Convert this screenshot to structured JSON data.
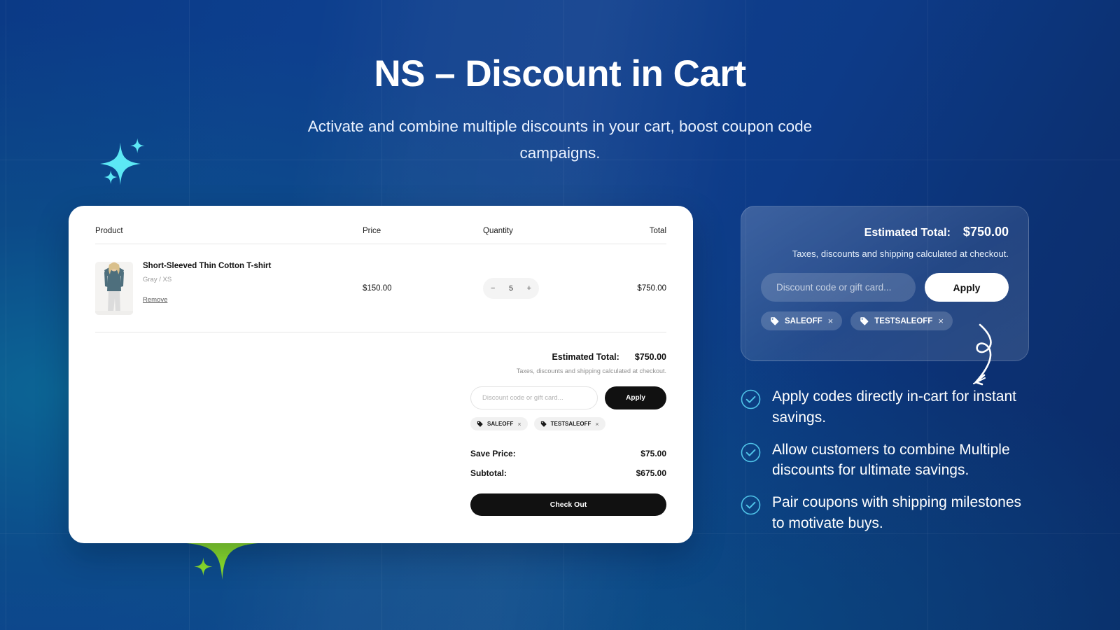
{
  "header": {
    "title": "NS – Discount in Cart",
    "subtitle": "Activate and combine multiple discounts in your cart, boost coupon code campaigns."
  },
  "colors": {
    "background_deep_blue": "#0c3277",
    "background_teal": "#0c6896",
    "sparkle_cyan": "#5ce8f5",
    "sparkle_green": "#8ce02a",
    "accent_check": "#4fc3e8",
    "button_dark": "#111111"
  },
  "cart": {
    "columns": {
      "product": "Product",
      "price": "Price",
      "quantity": "Quantity",
      "total": "Total"
    },
    "items": [
      {
        "name": "Short-Sleeved Thin Cotton T-shirt",
        "variant": "Gray / XS",
        "remove_label": "Remove",
        "price": "$150.00",
        "quantity": "5",
        "decrement": "−",
        "increment": "+",
        "total": "$750.00"
      }
    ],
    "summary": {
      "estimated_total_label": "Estimated Total:",
      "estimated_total_value": "$750.00",
      "note": "Taxes, discounts and shipping calculated at checkout.",
      "discount_placeholder": "Discount code or gift card...",
      "discount_value": "",
      "apply_label": "Apply",
      "chips": [
        {
          "code": "SALEOFF",
          "remove": "×",
          "icon": "tag-icon"
        },
        {
          "code": "TESTSALEOFF",
          "remove": "×",
          "icon": "tag-icon"
        }
      ],
      "save_price_label": "Save Price:",
      "save_price_value": "$75.00",
      "subtotal_label": "Subtotal:",
      "subtotal_value": "$675.00",
      "checkout_label": "Check Out"
    }
  },
  "callout": {
    "estimated_total_label": "Estimated Total:",
    "estimated_total_value": "$750.00",
    "note": "Taxes, discounts and shipping calculated at checkout.",
    "discount_placeholder": "Discount code or gift card...",
    "discount_value": "",
    "apply_label": "Apply",
    "chips": [
      {
        "code": "SALEOFF",
        "remove": "×",
        "icon": "tag-icon"
      },
      {
        "code": "TESTSALEOFF",
        "remove": "×",
        "icon": "tag-icon"
      }
    ]
  },
  "features": [
    {
      "icon": "check-circle-icon",
      "text": "Apply codes directly in-cart for instant savings."
    },
    {
      "icon": "check-circle-icon",
      "text": "Allow customers to combine Multiple discounts for ultimate savings."
    },
    {
      "icon": "check-circle-icon",
      "text": "Pair coupons with shipping milestones to motivate buys."
    }
  ],
  "decorations": {
    "sparkle_cyan": "sparkle-icon",
    "sparkle_green": "sparkle-icon",
    "arrow": "curved-arrow-icon"
  }
}
